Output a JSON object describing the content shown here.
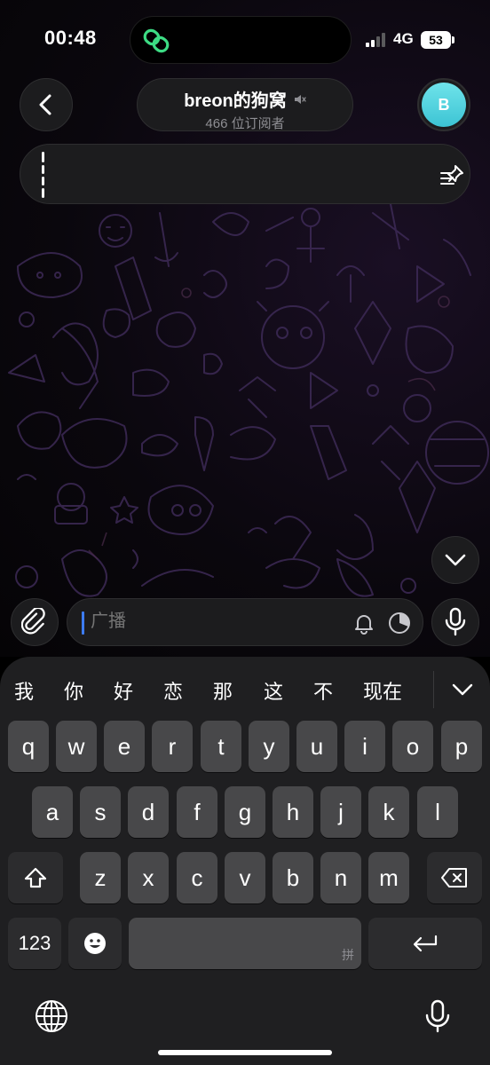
{
  "status_bar": {
    "time": "00:48",
    "network": "4G",
    "battery": "53"
  },
  "header": {
    "title": "breon的狗窝",
    "subtitle": "466 位订阅者",
    "avatar_initial": "B"
  },
  "composer": {
    "placeholder": "广播"
  },
  "keyboard": {
    "candidates": [
      "我",
      "你",
      "好",
      "恋",
      "那",
      "这",
      "不",
      "现在"
    ],
    "row1": [
      "q",
      "w",
      "e",
      "r",
      "t",
      "y",
      "u",
      "i",
      "o",
      "p"
    ],
    "row2": [
      "a",
      "s",
      "d",
      "f",
      "g",
      "h",
      "j",
      "k",
      "l"
    ],
    "row3": [
      "z",
      "x",
      "c",
      "v",
      "b",
      "n",
      "m"
    ],
    "numbers_key": "123",
    "space_mark": "拼"
  },
  "colors": {
    "accent": "#3d7cf5",
    "avatar": "#4fd2dd",
    "island_icon": "#3ddc84"
  }
}
